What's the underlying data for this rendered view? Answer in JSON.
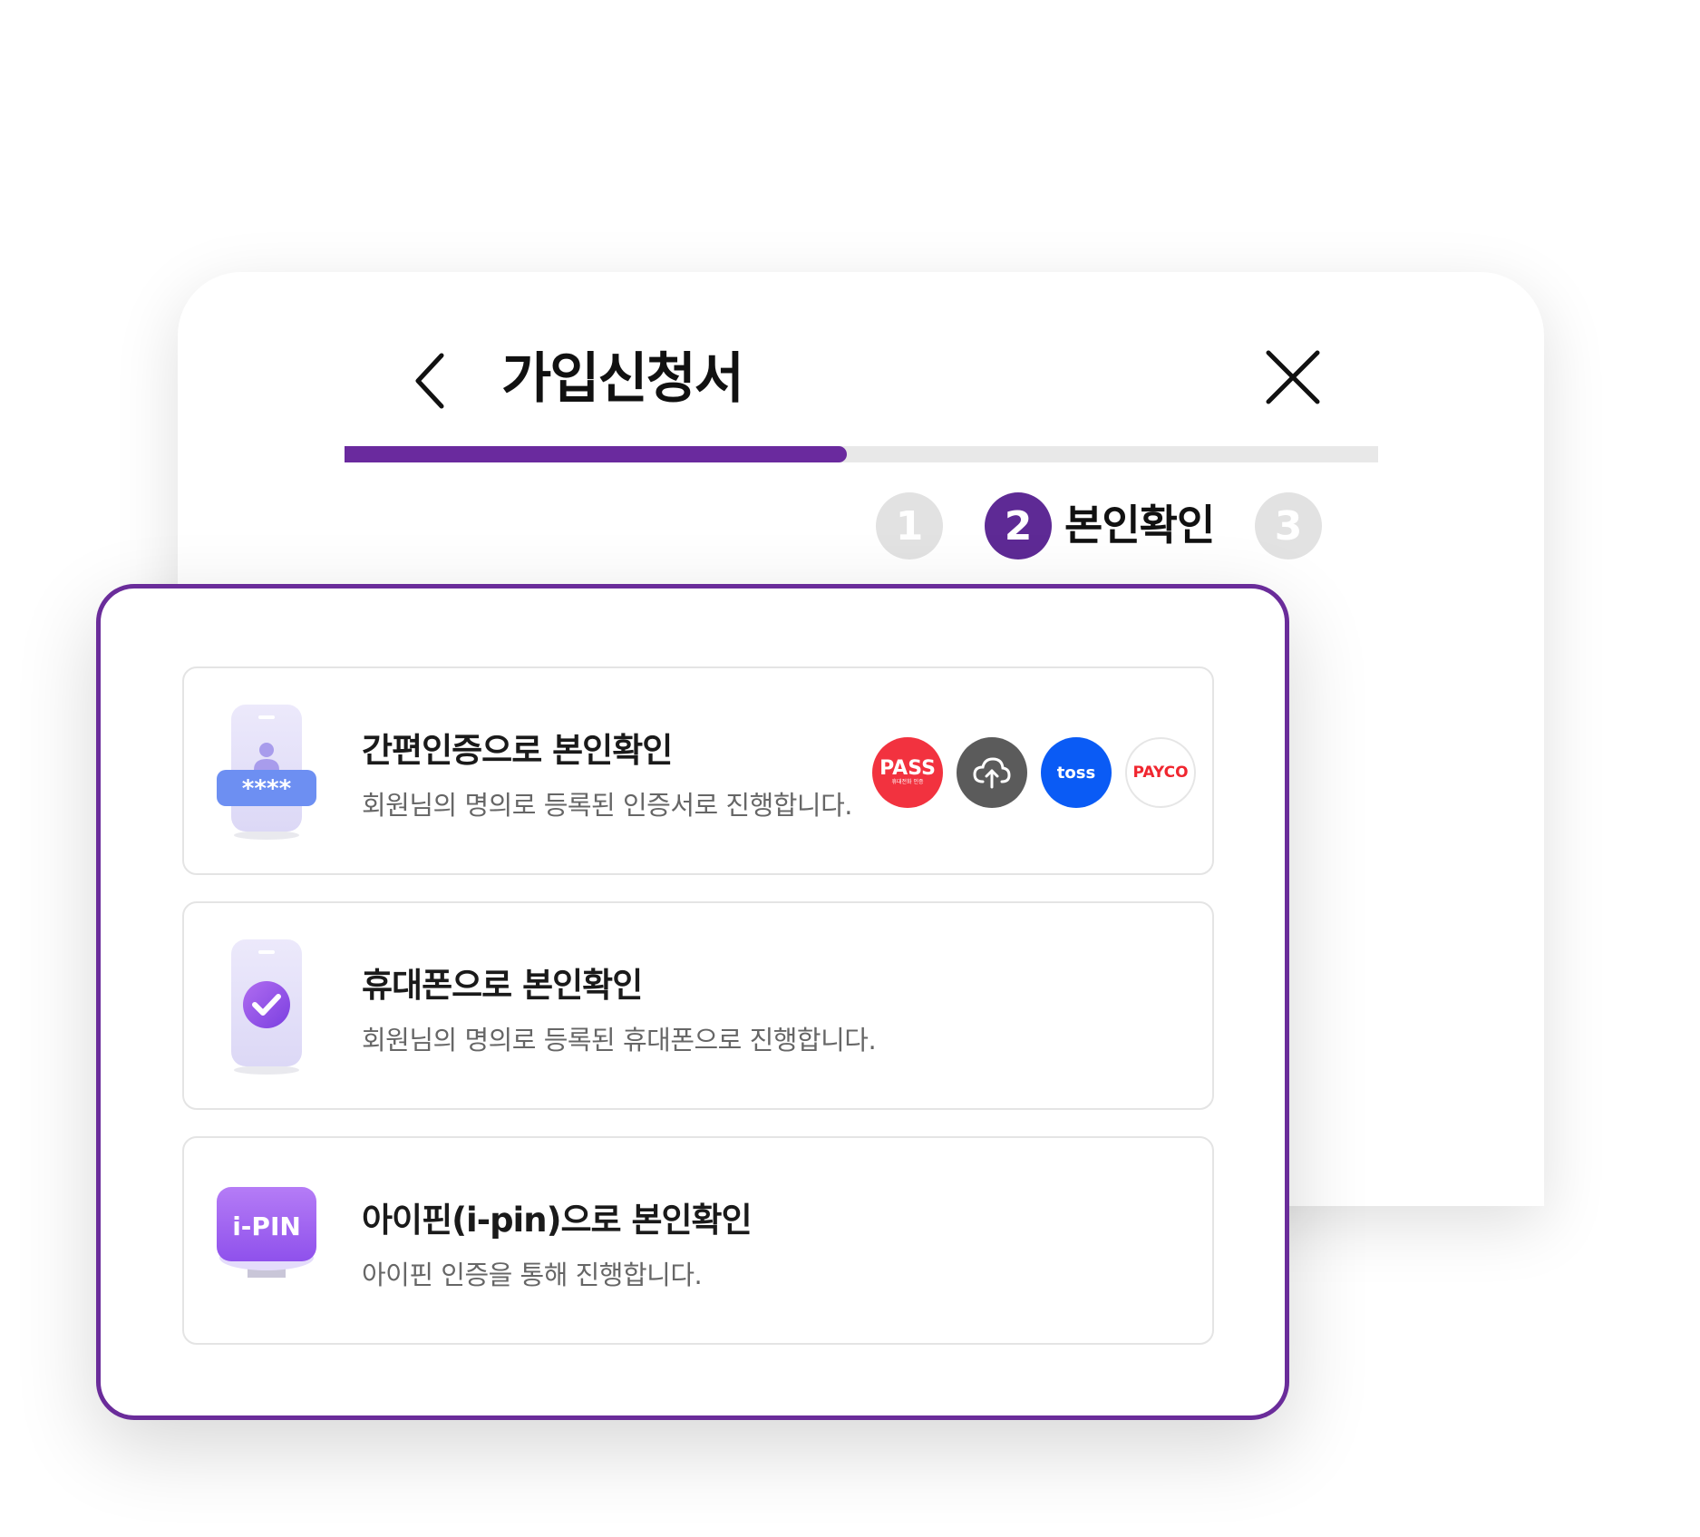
{
  "header": {
    "title": "가입신청서"
  },
  "progress": {
    "fraction": 0.486
  },
  "steps": [
    {
      "number": "1",
      "state": "inactive"
    },
    {
      "number": "2",
      "label": "본인확인",
      "state": "active"
    },
    {
      "number": "3",
      "state": "inactive"
    }
  ],
  "options": [
    {
      "title": "간편인증으로 본인확인",
      "desc": "회원님의 명의로 등록된 인증서로 진행합니다.",
      "icon": "phone-password-icon",
      "icon_text": "****",
      "providers": [
        {
          "name": "pass-logo",
          "text": "PASS",
          "subtext": "휴대전화 인증",
          "color": "#f2323f"
        },
        {
          "name": "cloud-certificate-icon",
          "color": "#5b5b5b"
        },
        {
          "name": "toss-logo",
          "text": "toss",
          "color": "#0a5bf5"
        },
        {
          "name": "payco-logo",
          "text": "PAYCO",
          "color": "#f0262f"
        }
      ]
    },
    {
      "title": "휴대폰으로 본인확인",
      "desc": "회원님의 명의로 등록된 휴대폰으로 진행합니다.",
      "icon": "phone-check-icon"
    },
    {
      "title": "아이핀(i-pin)으로 본인확인",
      "desc": "아이핀 인증을 통해 진행합니다.",
      "icon": "ipin-monitor-icon",
      "icon_text": "i-PIN"
    }
  ],
  "colors": {
    "accent": "#6a2a9e",
    "step_active": "#5e2a95",
    "step_inactive": "#e2e2e2",
    "border": "#6a2c9a"
  }
}
